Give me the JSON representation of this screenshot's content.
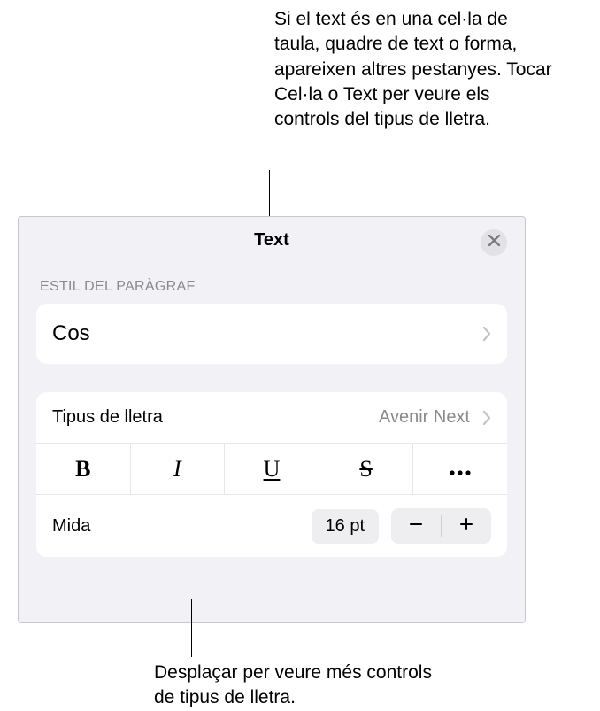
{
  "callouts": {
    "top": "Si el text és en una cel·la de taula, quadre de text o forma, apareixen altres pestanyes. Tocar Cel·la o Text per veure els controls del tipus de lletra.",
    "bottom": "Desplaçar per veure més controls de tipus de lletra."
  },
  "panel": {
    "title": "Text",
    "section_paragraph": "ESTIL DEL PARÀGRAF",
    "paragraph_style": "Cos",
    "font_label": "Tipus de lletra",
    "font_value": "Avenir Next",
    "format": {
      "bold": "B",
      "italic": "I",
      "underline": "U",
      "strike": "S"
    },
    "size_label": "Mida",
    "size_value": "16 pt"
  }
}
